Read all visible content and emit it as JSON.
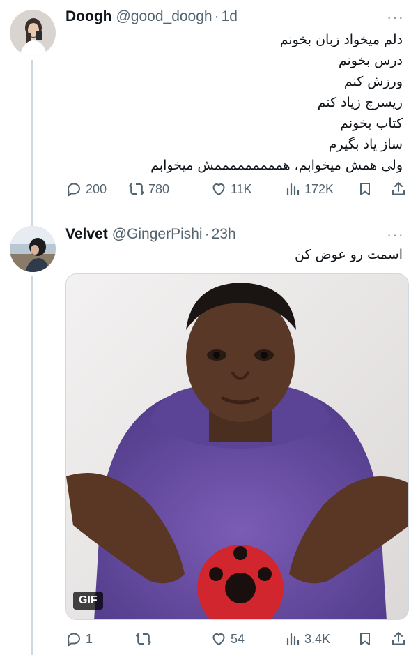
{
  "tweets": [
    {
      "name": "Doogh",
      "handle": "@good_doogh",
      "dot": "·",
      "time": "1d",
      "more": "···",
      "lines": [
        "دلم میخواد زبان بخونم",
        "درس بخونم",
        "ورزش کنم",
        "ریسرچ زیاد کنم",
        "کتاب بخونم",
        "ساز یاد بگیرم",
        "ولی همش میخوابم، همممممممممش میخوابم"
      ],
      "replies": "200",
      "retweets": "780",
      "likes": "11K",
      "views": "172K"
    },
    {
      "name": "Velvet",
      "handle": "@GingerPishi",
      "dot": "·",
      "time": "23h",
      "more": "···",
      "lines": [
        "اسمت رو عوض کن"
      ],
      "gif_label": "GIF",
      "replies": "1",
      "retweets": "",
      "likes": "54",
      "views": "3.4K"
    }
  ],
  "colors": {
    "text": "#0f1419",
    "muted": "#536471",
    "line": "#cfd9de",
    "hoodie": "#6a4fa3"
  },
  "icons": [
    "reply-icon",
    "retweet-icon",
    "like-icon",
    "views-icon",
    "bookmark-icon",
    "share-icon"
  ]
}
